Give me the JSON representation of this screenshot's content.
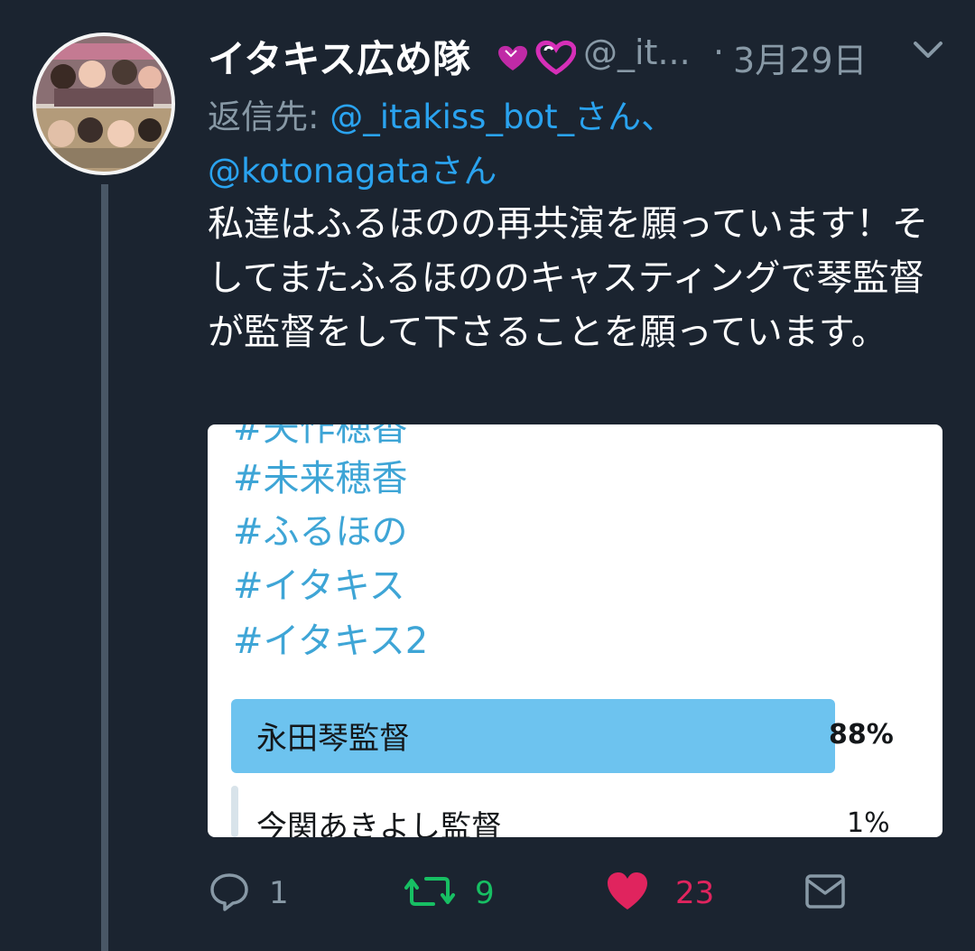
{
  "tweet": {
    "display_name": "イタキス広め隊",
    "handle": "@_it...",
    "separator": "·",
    "date": "3月29日",
    "replying_prefix": "返信先: ",
    "mention_1": "@_itakiss_bot_さん、",
    "mention_2": "@kotonagataさん",
    "text": "私達はふるほのの再共演を願っています！そしてまたふるほののキャスティングで琴監督が監督をして下さることを願っています。"
  },
  "media": {
    "hashtags": [
      "#矢作穂香",
      "#未来穂香",
      "#ふるほの",
      "#イタキス",
      "#イタキス2"
    ],
    "poll": [
      {
        "label": "永田琴監督",
        "percent": "88%",
        "fraction": 0.88
      },
      {
        "label": "今関あきよし監督",
        "percent": "1%",
        "fraction": 0.01
      }
    ]
  },
  "actions": {
    "replies": "1",
    "retweets": "9",
    "likes": "23"
  },
  "icons": {
    "reply": "reply-icon",
    "retweet": "retweet-icon",
    "like": "heart-icon",
    "dm": "envelope-icon",
    "more": "chevron-down-icon"
  },
  "colors": {
    "background": "#1b2430",
    "mention": "#2aa3ef",
    "muted": "#8899a6",
    "retweet": "#17bf63",
    "like": "#e0245e",
    "poll_bar": "#6dc3ef",
    "hashtag": "#3ea5d6"
  }
}
